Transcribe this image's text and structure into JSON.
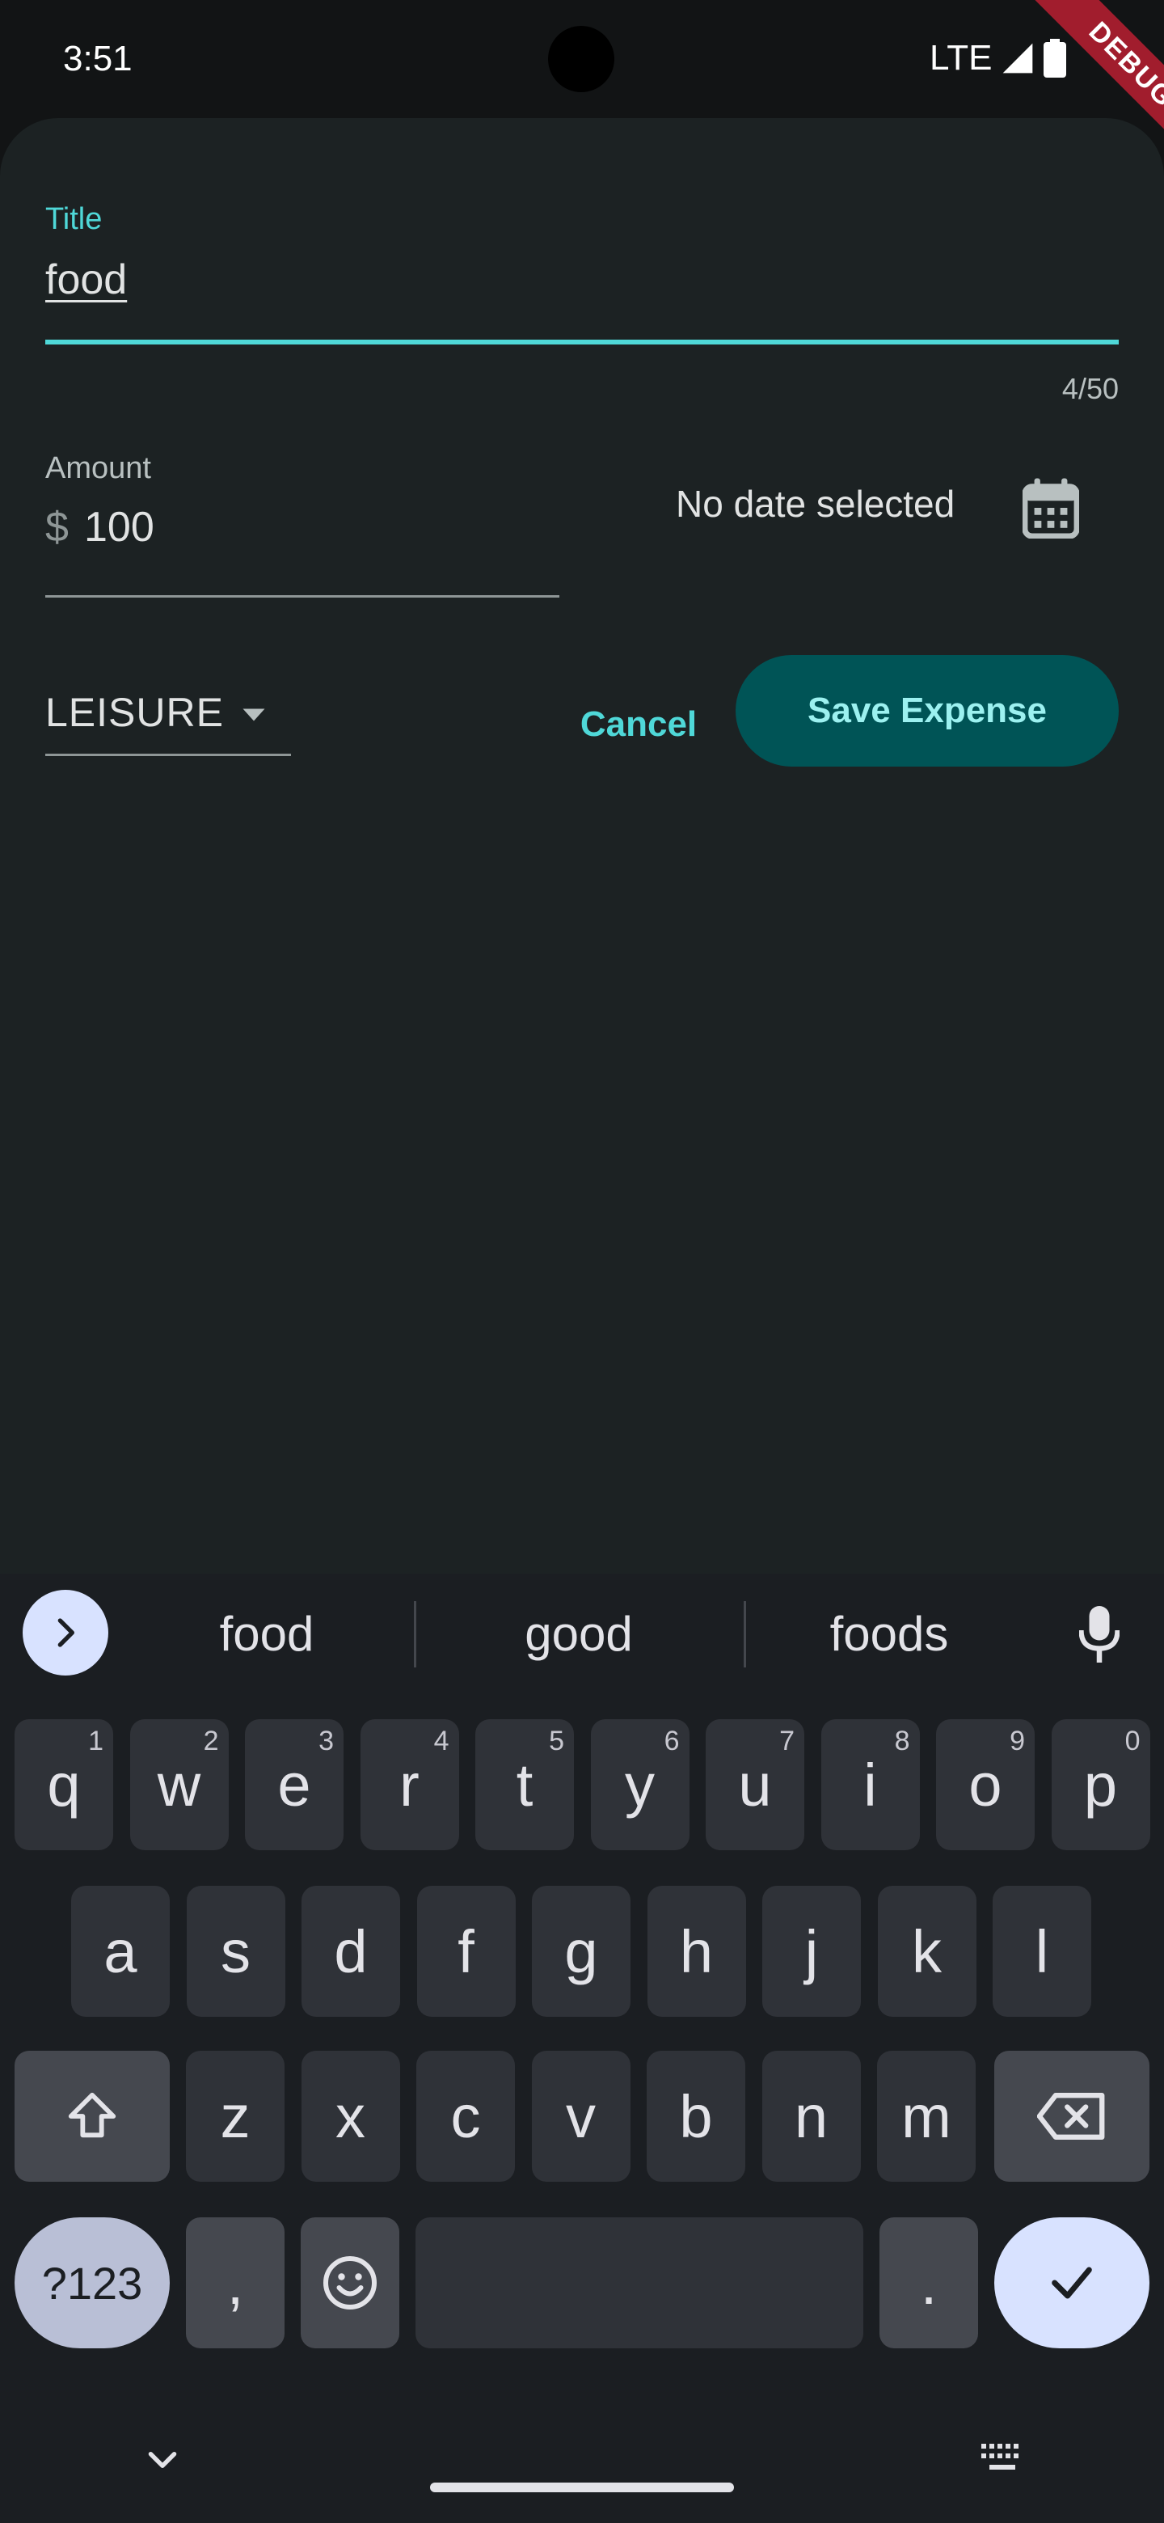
{
  "status_bar": {
    "time": "3:51",
    "network": "LTE",
    "debug_label": "DEBUG"
  },
  "form": {
    "title_label": "Title",
    "title_value": "food",
    "title_counter": "4/50",
    "amount_label": "Amount",
    "amount_prefix": "$",
    "amount_value": "100",
    "date_text": "No date selected",
    "category": "LEISURE",
    "cancel_label": "Cancel",
    "save_label": "Save Expense"
  },
  "keyboard": {
    "suggestions": [
      "food",
      "good",
      "foods"
    ],
    "row1": [
      {
        "k": "q",
        "h": "1"
      },
      {
        "k": "w",
        "h": "2"
      },
      {
        "k": "e",
        "h": "3"
      },
      {
        "k": "r",
        "h": "4"
      },
      {
        "k": "t",
        "h": "5"
      },
      {
        "k": "y",
        "h": "6"
      },
      {
        "k": "u",
        "h": "7"
      },
      {
        "k": "i",
        "h": "8"
      },
      {
        "k": "o",
        "h": "9"
      },
      {
        "k": "p",
        "h": "0"
      }
    ],
    "row2": [
      "a",
      "s",
      "d",
      "f",
      "g",
      "h",
      "j",
      "k",
      "l"
    ],
    "row3": [
      "z",
      "x",
      "c",
      "v",
      "b",
      "n",
      "m"
    ],
    "mode_label": "?123",
    "comma": ",",
    "period": "."
  },
  "colors": {
    "accent": "#4fd8d8",
    "sheet_bg": "#1c2223",
    "save_button_bg": "#005456",
    "keyboard_bg": "#1b1e22"
  }
}
